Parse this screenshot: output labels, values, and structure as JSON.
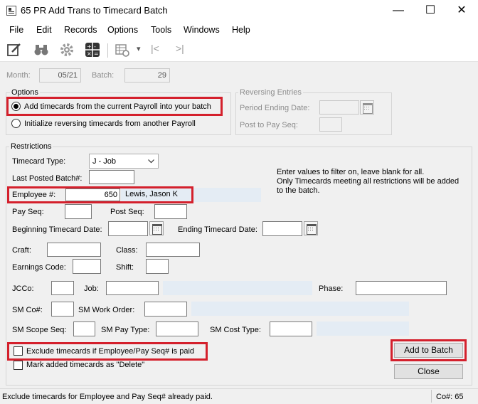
{
  "window": {
    "title": "65 PR Add Trans to Timecard Batch",
    "controls": {
      "minimize": "—",
      "maximize": "☐",
      "close": "✕"
    }
  },
  "menu": [
    "File",
    "Edit",
    "Records",
    "Options",
    "Tools",
    "Windows",
    "Help"
  ],
  "toolbar": {
    "icons": [
      "edit-notes-icon",
      "binoculars-icon",
      "gear-icon",
      "calculator-icon",
      "grid-settings-icon",
      "dropdown-arrow-icon",
      "first-record-icon",
      "last-record-icon"
    ],
    "dropdown_glyph": "▾",
    "first_glyph": "|<",
    "last_glyph": ">|"
  },
  "header": {
    "month_label": "Month:",
    "month_value": "05/21",
    "batch_label": "Batch:",
    "batch_value": "29"
  },
  "options": {
    "title": "Options",
    "radio_add": "Add timecards from the current Payroll into your batch",
    "radio_add_selected": true,
    "radio_reverse": "Initialize reversing timecards from another Payroll"
  },
  "reversing": {
    "title": "Reversing Entries",
    "period_label": "Period Ending Date:",
    "post_label": "Post to Pay Seq:"
  },
  "restrictions": {
    "title": "Restrictions",
    "timecard_type_label": "Timecard Type:",
    "timecard_type_value": "J - Job",
    "last_posted_label": "Last Posted Batch#:",
    "hint": "Enter values to filter on, leave blank for all.\nOnly Timecards meeting all restrictions will be added\nto the batch.",
    "employee_label": "Employee #:",
    "employee_value": "650",
    "employee_name": "Lewis, Jason K",
    "pay_seq_label": "Pay Seq:",
    "post_seq_label": "Post Seq:",
    "beg_date_label": "Beginning Timecard Date:",
    "end_date_label": "Ending Timecard Date:",
    "craft_label": "Craft:",
    "class_label": "Class:",
    "earnings_label": "Earnings Code:",
    "shift_label": "Shift:",
    "jcco_label": "JCCo:",
    "job_label": "Job:",
    "phase_label": "Phase:",
    "smco_label": "SM Co#:",
    "sm_work_order_label": "SM Work Order:",
    "sm_scope_label": "SM Scope Seq:",
    "sm_pay_type_label": "SM Pay Type:",
    "sm_cost_type_label": "SM Cost Type:",
    "exclude_label": "Exclude timecards if Employee/Pay Seq# is paid",
    "delete_label": "Mark added timecards as \"Delete\""
  },
  "buttons": {
    "add_to_batch": "Add to Batch",
    "close": "Close"
  },
  "status": {
    "message": "Exclude timecards for Employee and Pay Seq# already paid.",
    "company": "Co#: 65"
  },
  "colors": {
    "highlight": "#d4202c",
    "readonly_field": "#e4ecf4"
  }
}
